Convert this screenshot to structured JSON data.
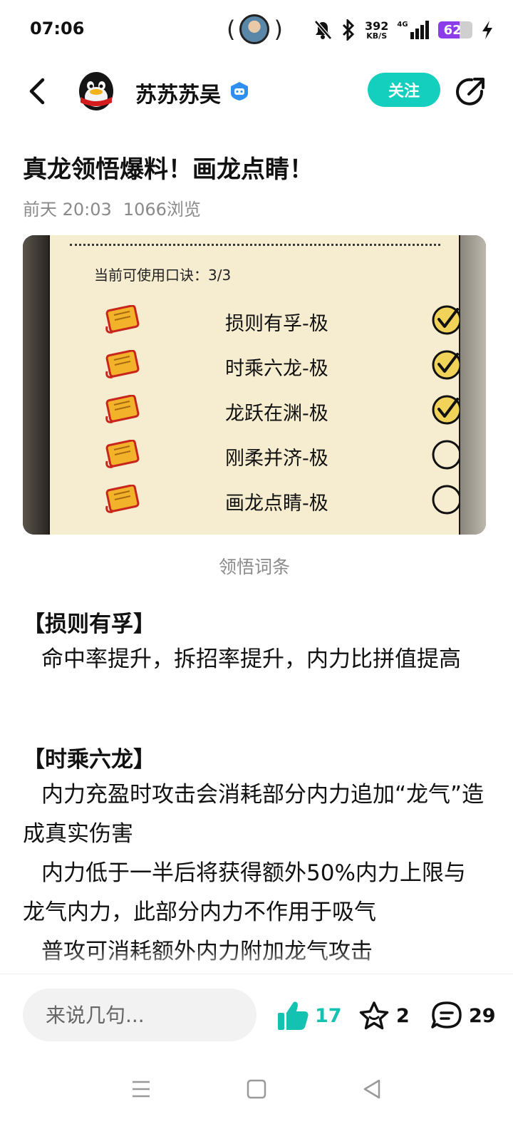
{
  "status_bar": {
    "time": "07:06",
    "net_speed_value": "392",
    "net_speed_unit": "KB/S",
    "network_type": "4G",
    "battery": "62",
    "icons": [
      "mute-icon",
      "bluetooth-icon",
      "signal-icon",
      "charging-icon"
    ]
  },
  "header": {
    "user_name": "苏苏苏吴",
    "follow_label": "关注"
  },
  "post": {
    "title": "真龙领悟爆料！画龙点睛！",
    "time": "前天 20:03",
    "views": "1066浏览"
  },
  "game_image": {
    "count_label": "当前可使用口诀：3/3",
    "mantras": [
      {
        "name": "损则有孚-极",
        "checked": true
      },
      {
        "name": "时乘六龙-极",
        "checked": true
      },
      {
        "name": "龙跃在渊-极",
        "checked": true
      },
      {
        "name": "刚柔并济-极",
        "checked": false
      },
      {
        "name": "画龙点睛-极",
        "checked": false
      }
    ],
    "caption": "领悟词条"
  },
  "content": {
    "section1_heading": "【损则有孚】",
    "section1_p1": "命中率提升，拆招率提升，内力比拼值提高",
    "section2_heading": "【时乘六龙】",
    "section2_p1": "内力充盈时攻击会消耗部分内力追加“龙气”造成真实伤害",
    "section2_p2": "内力低于一半后将获得额外50%内力上限与龙气内力，此部分内力不作用于吸气",
    "section2_p3": "普攻可消耗额外内力附加龙气攻击"
  },
  "bottom_bar": {
    "comment_placeholder": "来说几句...",
    "likes": "17",
    "favorites": "2",
    "comments": "29",
    "accent_color": "#14cfbd"
  }
}
